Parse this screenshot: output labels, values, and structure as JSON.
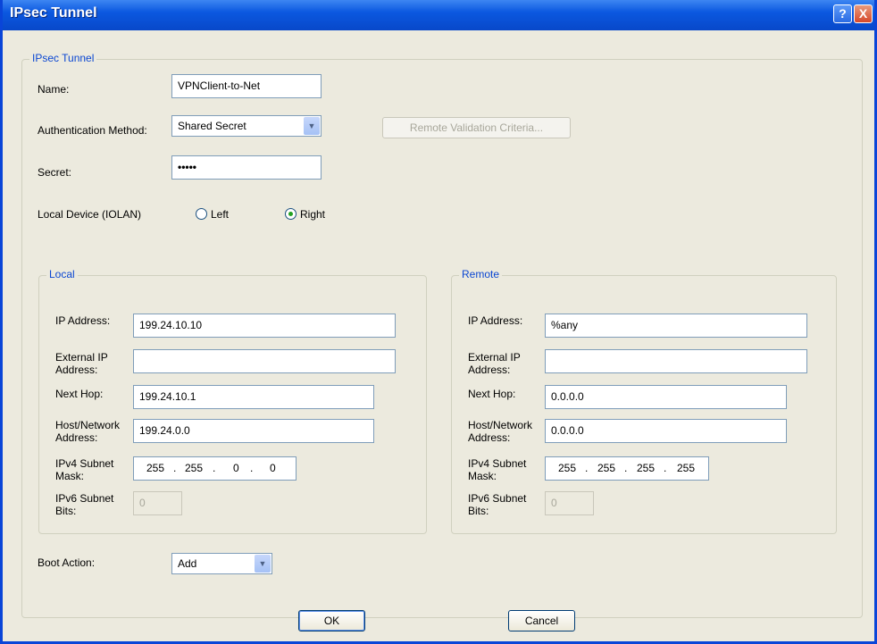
{
  "window": {
    "title": "IPsec Tunnel",
    "help_glyph": "?",
    "close_glyph": "X"
  },
  "tunnel": {
    "group_title": "IPsec Tunnel",
    "name_label": "Name:",
    "name_value": "VPNClient-to-Net",
    "auth_label": "Authentication Method:",
    "auth_value": "Shared Secret",
    "remote_validation_label": "Remote Validation Criteria...",
    "secret_label": "Secret:",
    "secret_value": "•••••",
    "local_device_label": "Local Device (IOLAN)",
    "radio_left": "Left",
    "radio_right": "Right"
  },
  "local": {
    "group_title": "Local",
    "ip_label": "IP Address:",
    "ip_value": "199.24.10.10",
    "ext_label": "External IP Address:",
    "ext_value": "",
    "hop_label": "Next Hop:",
    "hop_value": "199.24.10.1",
    "host_label": "Host/Network Address:",
    "host_value": "199.24.0.0",
    "mask_label": "IPv4 Subnet Mask:",
    "mask": [
      "255",
      "255",
      "0",
      "0"
    ],
    "v6_label": "IPv6 Subnet Bits:",
    "v6_value": "0"
  },
  "remote": {
    "group_title": "Remote",
    "ip_label": "IP Address:",
    "ip_value": "%any",
    "ext_label": "External IP Address:",
    "ext_value": "",
    "hop_label": "Next Hop:",
    "hop_value": "0.0.0.0",
    "host_label": "Host/Network Address:",
    "host_value": "0.0.0.0",
    "mask_label": "IPv4 Subnet Mask:",
    "mask": [
      "255",
      "255",
      "255",
      "255"
    ],
    "v6_label": "IPv6 Subnet Bits:",
    "v6_value": "0"
  },
  "boot": {
    "label": "Boot Action:",
    "value": "Add"
  },
  "buttons": {
    "ok": "OK",
    "cancel": "Cancel"
  },
  "colors": {
    "titlebar": "#0b58e0",
    "dialog_bg": "#eceade",
    "group_title": "#0b47d2"
  }
}
